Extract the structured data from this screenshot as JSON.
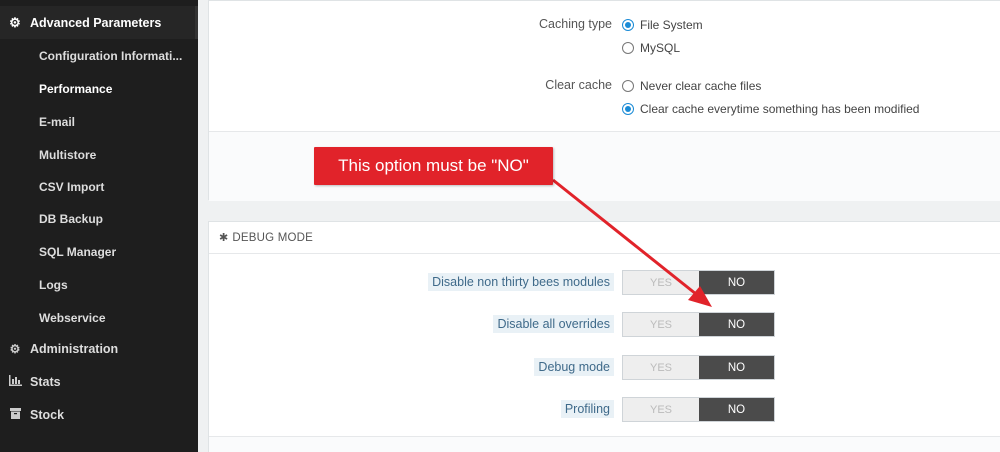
{
  "sidebar": {
    "active_section": "Advanced Parameters",
    "sub_items": [
      {
        "label": "Configuration Informati..."
      },
      {
        "label": "Performance"
      },
      {
        "label": "E-mail"
      },
      {
        "label": "Multistore"
      },
      {
        "label": "CSV Import"
      },
      {
        "label": "DB Backup"
      },
      {
        "label": "SQL Manager"
      },
      {
        "label": "Logs"
      },
      {
        "label": "Webservice"
      }
    ],
    "main_items": [
      {
        "label": "Administration",
        "icon": "gear-icon"
      },
      {
        "label": "Stats",
        "icon": "bar-chart-icon"
      },
      {
        "label": "Stock",
        "icon": "box-icon"
      }
    ]
  },
  "caching": {
    "label": "Caching type",
    "options": [
      {
        "label": "File System",
        "checked": true
      },
      {
        "label": "MySQL",
        "checked": false
      }
    ]
  },
  "clear_cache": {
    "label": "Clear cache",
    "options": [
      {
        "label": "Never clear cache files",
        "checked": false
      },
      {
        "label": "Clear cache everytime something has been modified",
        "checked": true
      }
    ]
  },
  "debug": {
    "title": "DEBUG MODE",
    "rows": [
      {
        "label": "Disable non thirty bees modules",
        "yes": "YES",
        "no": "NO",
        "value": "NO"
      },
      {
        "label": "Disable all overrides",
        "yes": "YES",
        "no": "NO",
        "value": "NO"
      },
      {
        "label": "Debug mode",
        "yes": "YES",
        "no": "NO",
        "value": "NO"
      },
      {
        "label": "Profiling",
        "yes": "YES",
        "no": "NO",
        "value": "NO"
      }
    ]
  },
  "annotation": {
    "text": "This option must be \"NO\"",
    "color": "#e1232a"
  },
  "colors": {
    "sidebar_bg": "#1e1e1e",
    "accent": "#1a8bd6",
    "switch_on": "#4b4b4b"
  }
}
